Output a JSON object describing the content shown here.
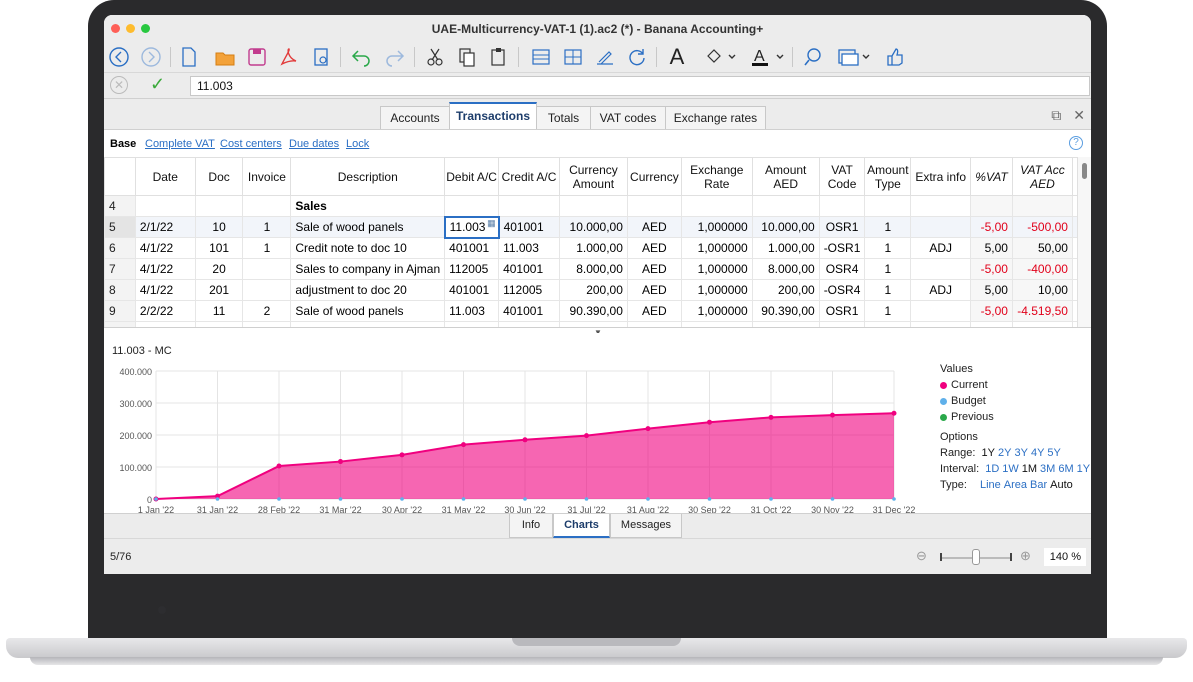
{
  "window": {
    "title": "UAE-Multicurrency-VAT-1 (1).ac2 (*) - Banana Accounting+"
  },
  "formula_bar": {
    "value": "11.003"
  },
  "tabs": [
    "Accounts",
    "Transactions",
    "Totals",
    "VAT codes",
    "Exchange rates"
  ],
  "active_tab": "Transactions",
  "views": [
    "Base",
    "Complete VAT",
    "Cost centers",
    "Due dates",
    "Lock"
  ],
  "columns": [
    "Date",
    "Doc",
    "Invoice",
    "Description",
    "Debit A/C",
    "Credit A/C",
    "Currency Amount",
    "Currency",
    "Exchange Rate",
    "Amount AED",
    "VAT Code",
    "Amount Type",
    "Extra info",
    "%VAT",
    "VAT Acc AED"
  ],
  "rows": [
    {
      "n": "4",
      "date": "",
      "doc": "",
      "inv": "",
      "desc": "Sales",
      "debit": "",
      "credit": "",
      "camt": "",
      "cur": "",
      "rate": "",
      "amt": "",
      "vat": "",
      "atype": "",
      "extra": "",
      "pvat": "",
      "vacc": ""
    },
    {
      "n": "5",
      "date": "2/1/22",
      "doc": "10",
      "inv": "1",
      "desc": "Sale of wood panels",
      "debit": "11.003",
      "credit": "401001",
      "camt": "10.000,00",
      "cur": "AED",
      "rate": "1,000000",
      "amt": "10.000,00",
      "vat": "OSR1",
      "atype": "1",
      "extra": "",
      "pvat": "-5,00",
      "vacc": "-500,00"
    },
    {
      "n": "6",
      "date": "4/1/22",
      "doc": "101",
      "inv": "1",
      "desc": "Credit note to doc 10",
      "debit": "401001",
      "credit": "11.003",
      "camt": "1.000,00",
      "cur": "AED",
      "rate": "1,000000",
      "amt": "1.000,00",
      "vat": "-OSR1",
      "atype": "1",
      "extra": "ADJ",
      "pvat": "5,00",
      "vacc": "50,00"
    },
    {
      "n": "7",
      "date": "4/1/22",
      "doc": "20",
      "inv": "",
      "desc": "Sales to company in Ajman",
      "debit": "112005",
      "credit": "401001",
      "camt": "8.000,00",
      "cur": "AED",
      "rate": "1,000000",
      "amt": "8.000,00",
      "vat": "OSR4",
      "atype": "1",
      "extra": "",
      "pvat": "-5,00",
      "vacc": "-400,00"
    },
    {
      "n": "8",
      "date": "4/1/22",
      "doc": "201",
      "inv": "",
      "desc": "adjustment to doc 20",
      "debit": "401001",
      "credit": "112005",
      "camt": "200,00",
      "cur": "AED",
      "rate": "1,000000",
      "amt": "200,00",
      "vat": "-OSR4",
      "atype": "1",
      "extra": "ADJ",
      "pvat": "5,00",
      "vacc": "10,00"
    },
    {
      "n": "9",
      "date": "2/2/22",
      "doc": "11",
      "inv": "2",
      "desc": "Sale of wood panels",
      "debit": "11.003",
      "credit": "401001",
      "camt": "90.390,00",
      "cur": "AED",
      "rate": "1,000000",
      "amt": "90.390,00",
      "vat": "OSR1",
      "atype": "1",
      "extra": "",
      "pvat": "-5,00",
      "vacc": "-4.519,50"
    }
  ],
  "chart_title": "11.003 - MC",
  "chart_data": {
    "type": "area",
    "x": [
      "1 Jan '22",
      "31 Jan '22",
      "28 Feb '22",
      "31 Mar '22",
      "30 Apr '22",
      "31 May '22",
      "30 Jun '22",
      "31 Jul '22",
      "31 Aug '22",
      "30 Sep '22",
      "31 Oct '22",
      "30 Nov '22",
      "31 Dec '22"
    ],
    "series": [
      {
        "name": "Current",
        "values": [
          0,
          9000,
          103000,
          117000,
          138000,
          170000,
          185000,
          198000,
          220000,
          240000,
          255000,
          262000,
          268000
        ]
      }
    ],
    "ylim": [
      0,
      400000
    ],
    "yticks": [
      "0",
      "100.000",
      "200.000",
      "300.000",
      "400.000"
    ],
    "grid": true,
    "color": "#f0007f"
  },
  "legend": {
    "title": "Values",
    "items": [
      {
        "label": "Current",
        "color": "#f0007f"
      },
      {
        "label": "Budget",
        "color": "#5fb0ea"
      },
      {
        "label": "Previous",
        "color": "#2aa84a"
      }
    ],
    "options_title": "Options",
    "range_label": "Range:",
    "range": [
      "1Y",
      "2Y",
      "3Y",
      "4Y",
      "5Y"
    ],
    "interval_label": "Interval:",
    "interval": [
      "1D",
      "1W",
      "1M",
      "3M",
      "6M",
      "1Y"
    ],
    "type_label": "Type:",
    "types": [
      "Line",
      "Area",
      "Bar",
      "Auto"
    ]
  },
  "bottom_tabs": [
    "Info",
    "Charts",
    "Messages"
  ],
  "status": {
    "position": "5/76",
    "zoom": "140 %"
  }
}
